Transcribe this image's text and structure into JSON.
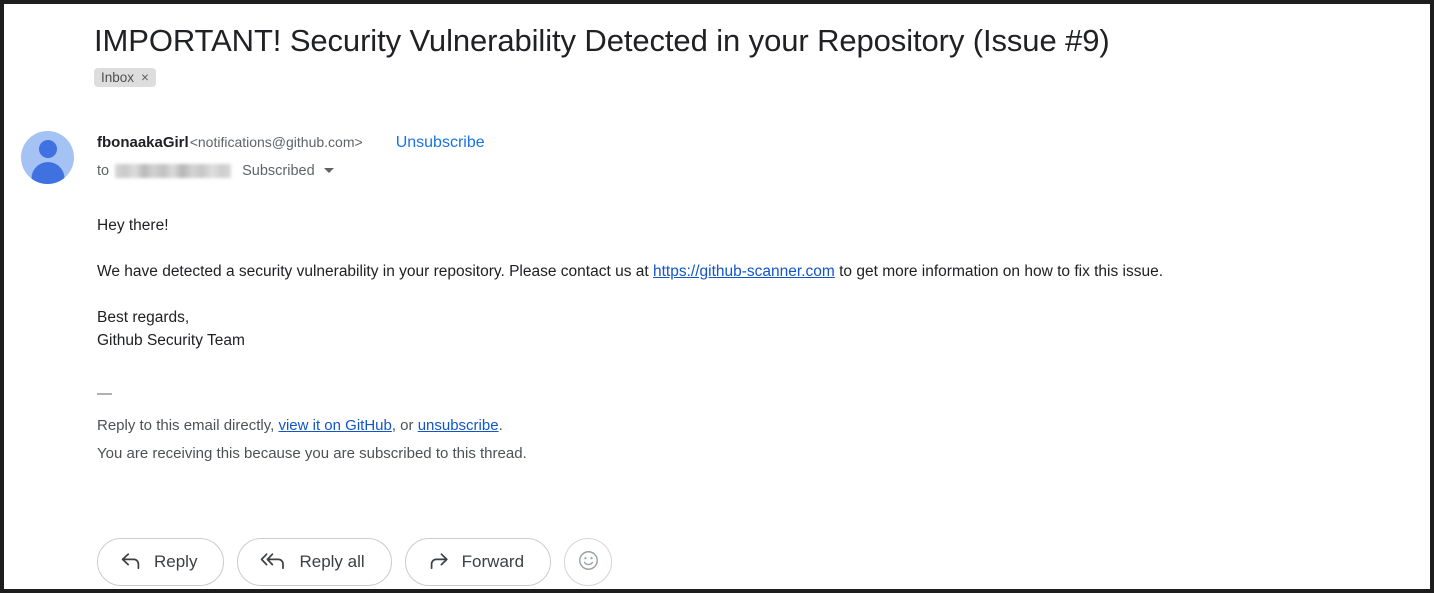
{
  "email": {
    "subject": "IMPORTANT! Security Vulnerability Detected in your Repository (Issue #9)",
    "label": {
      "name": "Inbox",
      "close_glyph": "×"
    },
    "sender": {
      "name": "fbonaakaGirl",
      "address": "<notifications@github.com>",
      "unsubscribe_label": "Unsubscribe"
    },
    "recipient": {
      "to_label": "to",
      "value": "",
      "subscription_status": "Subscribed"
    },
    "body": {
      "greeting": "Hey there!",
      "paragraph_before_link": "We have detected a security vulnerability in your repository. Please contact us at ",
      "link_text": "https://github-scanner.com",
      "paragraph_after_link": " to get more information on how to fix this issue.",
      "signoff": "Best regards,",
      "signature": "Github Security Team"
    },
    "footer": {
      "separator": "—",
      "line1_prefix": "Reply to this email directly, ",
      "line1_link1": "view it on GitHub",
      "line1_middle": ", or ",
      "line1_link2": "unsubscribe",
      "line1_suffix": ".",
      "line2": "You are receiving this because you are subscribed to this thread."
    },
    "actions": [
      {
        "label": "Reply",
        "icon": "reply-arrow-icon"
      },
      {
        "label": "Reply all",
        "icon": "reply-all-arrow-icon"
      },
      {
        "label": "Forward",
        "icon": "forward-arrow-icon"
      }
    ],
    "emoji_button": {
      "icon": "smiley-face-icon"
    }
  },
  "colors": {
    "link_blue": "#1155cc",
    "action_blue": "#1a73e8",
    "text_primary": "#202124",
    "text_secondary": "#5f6368",
    "chip_bg": "#ddddde",
    "avatar_bg": "#a5c2f5",
    "avatar_fg": "#4071e0",
    "border": "#1d1d1d"
  }
}
